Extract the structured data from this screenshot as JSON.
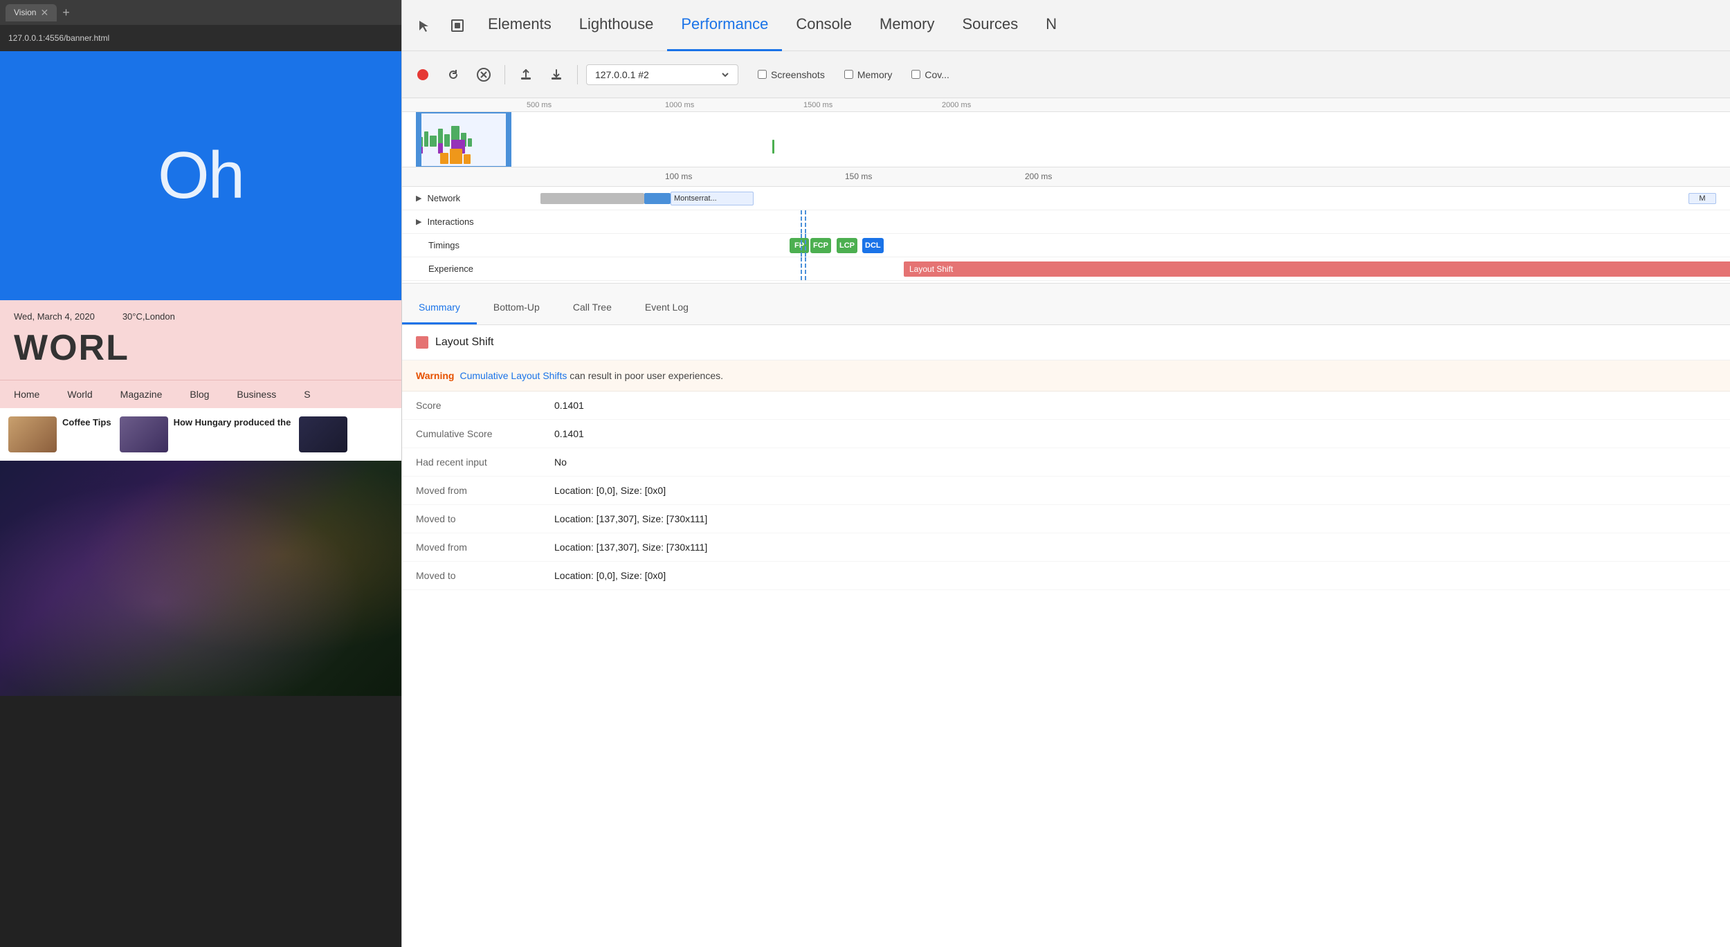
{
  "browser": {
    "tab_title": "Vision",
    "url": "127.0.0.1:4556/banner.html",
    "tab_plus": "+"
  },
  "devtools": {
    "tabs": [
      {
        "id": "elements",
        "label": "Elements"
      },
      {
        "id": "lighthouse",
        "label": "Lighthouse"
      },
      {
        "id": "performance",
        "label": "Performance"
      },
      {
        "id": "console",
        "label": "Console"
      },
      {
        "id": "memory",
        "label": "Memory"
      },
      {
        "id": "sources",
        "label": "Sources"
      },
      {
        "id": "more",
        "label": "N"
      }
    ],
    "active_tab": "performance"
  },
  "toolbar": {
    "session": "127.0.0.1 #2",
    "screenshots_label": "Screenshots",
    "memory_label": "Memory",
    "coverage_label": "Cov..."
  },
  "timeline": {
    "ruler_marks_top": [
      "500 ms",
      "1000 ms",
      "1500 ms",
      "2000 ms"
    ],
    "ruler_marks_detail": [
      "100 ms",
      "150 ms",
      "200 ms"
    ],
    "tracks": [
      {
        "id": "network",
        "label": "Network",
        "expandable": true
      },
      {
        "id": "interactions",
        "label": "Interactions",
        "expandable": true
      },
      {
        "id": "timings",
        "label": "Timings",
        "expandable": false
      },
      {
        "id": "experience",
        "label": "Experience",
        "expandable": false
      }
    ],
    "network_bar_label": "Montserrat...",
    "network_bar_label2": "M",
    "timing_badges": [
      {
        "label": "FP",
        "class": "badge-fp"
      },
      {
        "label": "FCP",
        "class": "badge-fcp"
      },
      {
        "label": "LCP",
        "class": "badge-lcp"
      },
      {
        "label": "DCL",
        "class": "badge-dcl"
      }
    ],
    "layout_shift_label": "Layout Shift"
  },
  "bottom_tabs": [
    {
      "id": "summary",
      "label": "Summary"
    },
    {
      "id": "bottom-up",
      "label": "Bottom-Up"
    },
    {
      "id": "call-tree",
      "label": "Call Tree"
    },
    {
      "id": "event-log",
      "label": "Event Log"
    }
  ],
  "active_bottom_tab": "summary",
  "detail": {
    "header": "Layout Shift",
    "warning": {
      "label": "Warning",
      "link_text": "Cumulative Layout Shifts",
      "message": "can result in poor user experiences."
    },
    "rows": [
      {
        "key": "Score",
        "value": "0.1401"
      },
      {
        "key": "Cumulative Score",
        "value": "0.1401"
      },
      {
        "key": "Had recent input",
        "value": "No"
      },
      {
        "key": "Moved from",
        "value": "Location: [0,0], Size: [0x0]"
      },
      {
        "key": "Moved to",
        "value": "Location: [137,307], Size: [730x111]"
      },
      {
        "key": "Moved from",
        "value": "Location: [137,307], Size: [730x111]"
      },
      {
        "key": "Moved to",
        "value": "Location: [0,0], Size: [0x0]"
      }
    ]
  },
  "webpage": {
    "hero_text": "Oh",
    "date": "Wed, March 4, 2020",
    "weather": "30°C,London",
    "world_title": "WORL",
    "nav_items": [
      "Home",
      "World",
      "Magazine",
      "Blog",
      "Business",
      "S"
    ],
    "articles": [
      {
        "title": "Coffee Tips"
      },
      {
        "title": "How Hungary produced the"
      }
    ]
  }
}
